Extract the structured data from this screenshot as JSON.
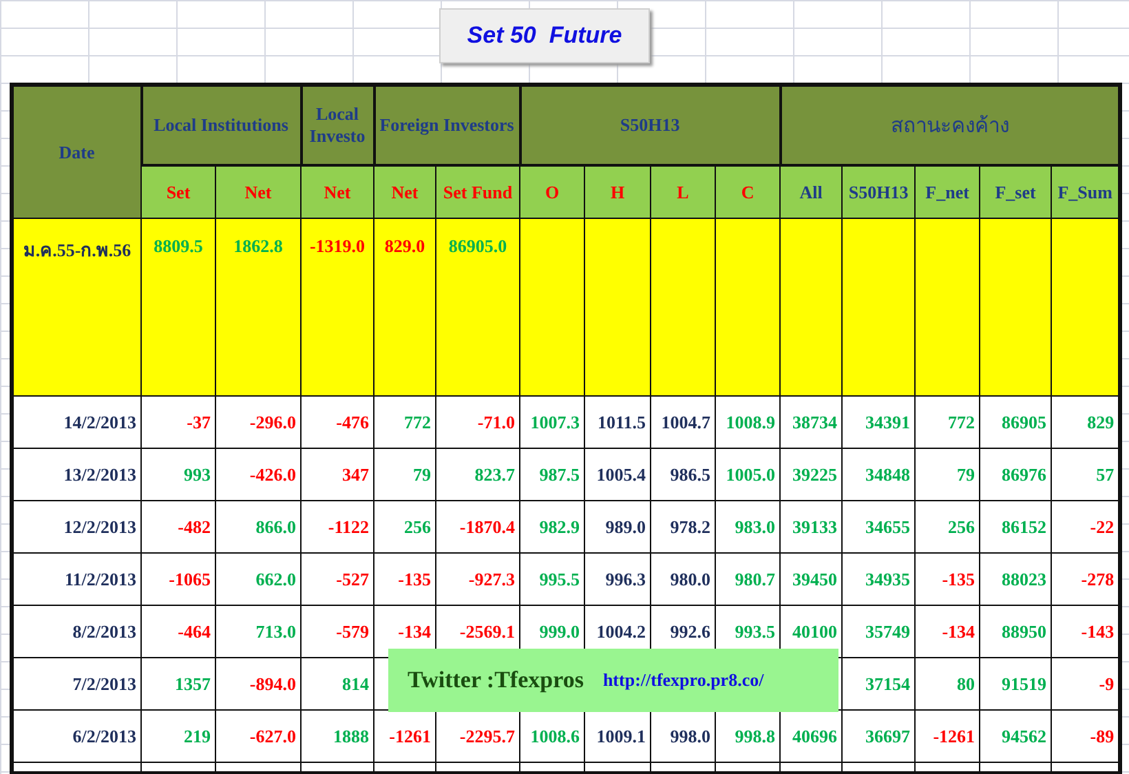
{
  "title": "Set 50  Future",
  "header": {
    "groups": [
      {
        "label": "Date"
      },
      {
        "label": "Local Institutions",
        "kind": "flow",
        "columns": [
          "Set",
          "Net"
        ]
      },
      {
        "label": "Local Investo",
        "kind": "flow",
        "columns": [
          "Net"
        ]
      },
      {
        "label": "Foreign Investors",
        "kind": "flow",
        "columns": [
          "Net",
          "Set Fund"
        ]
      },
      {
        "label": "S50H13",
        "kind": "flow",
        "columns": [
          "O",
          "H",
          "L",
          "C"
        ]
      },
      {
        "label": "สถานะคงค้าง",
        "kind": "position",
        "columns": [
          "All",
          "S50H13",
          "F_net",
          "F_set",
          "F_Sum"
        ]
      }
    ]
  },
  "summary": {
    "label": "ม.ค.55-ก.พ.56",
    "cells": [
      {
        "text": "8809.5",
        "color": "#00b050"
      },
      {
        "text": "1862.8",
        "color": "#00b050"
      },
      {
        "text": "-1319.0",
        "color": "#ff0000"
      },
      {
        "text": "829.0",
        "color": "#ff0000"
      },
      {
        "text": "86905.0",
        "color": "#00b050"
      }
    ]
  },
  "rows": [
    {
      "date": "14/2/2013",
      "cells": [
        {
          "text": "-37",
          "color": "#ff0000"
        },
        {
          "text": "-296.0",
          "color": "#ff0000"
        },
        {
          "text": "-476",
          "color": "#ff0000"
        },
        {
          "text": "772",
          "color": "#00b050"
        },
        {
          "text": "-71.0",
          "color": "#ff0000"
        },
        {
          "text": "1007.3",
          "color": "#00b050"
        },
        {
          "text": "1011.5",
          "color": "#1f2f5c"
        },
        {
          "text": "1004.7",
          "color": "#1f2f5c"
        },
        {
          "text": "1008.9",
          "color": "#00b050"
        },
        {
          "text": "38734",
          "color": "#00b050"
        },
        {
          "text": "34391",
          "color": "#00b050"
        },
        {
          "text": "772",
          "color": "#00b050"
        },
        {
          "text": "86905",
          "color": "#00b050"
        },
        {
          "text": "829",
          "color": "#00b050"
        }
      ]
    },
    {
      "date": "13/2/2013",
      "cells": [
        {
          "text": "993",
          "color": "#00b050"
        },
        {
          "text": "-426.0",
          "color": "#ff0000"
        },
        {
          "text": "347",
          "color": "#ff0000"
        },
        {
          "text": "79",
          "color": "#00b050"
        },
        {
          "text": "823.7",
          "color": "#00b050"
        },
        {
          "text": "987.5",
          "color": "#00b050"
        },
        {
          "text": "1005.4",
          "color": "#1f2f5c"
        },
        {
          "text": "986.5",
          "color": "#1f2f5c"
        },
        {
          "text": "1005.0",
          "color": "#00b050"
        },
        {
          "text": "39225",
          "color": "#00b050"
        },
        {
          "text": "34848",
          "color": "#00b050"
        },
        {
          "text": "79",
          "color": "#00b050"
        },
        {
          "text": "86976",
          "color": "#00b050"
        },
        {
          "text": "57",
          "color": "#00b050"
        }
      ]
    },
    {
      "date": "12/2/2013",
      "cells": [
        {
          "text": "-482",
          "color": "#ff0000"
        },
        {
          "text": "866.0",
          "color": "#00b050"
        },
        {
          "text": "-1122",
          "color": "#ff0000"
        },
        {
          "text": "256",
          "color": "#00b050"
        },
        {
          "text": "-1870.4",
          "color": "#ff0000"
        },
        {
          "text": "982.9",
          "color": "#00b050"
        },
        {
          "text": "989.0",
          "color": "#1f2f5c"
        },
        {
          "text": "978.2",
          "color": "#1f2f5c"
        },
        {
          "text": "983.0",
          "color": "#00b050"
        },
        {
          "text": "39133",
          "color": "#00b050"
        },
        {
          "text": "34655",
          "color": "#00b050"
        },
        {
          "text": "256",
          "color": "#00b050"
        },
        {
          "text": "86152",
          "color": "#00b050"
        },
        {
          "text": "-22",
          "color": "#ff0000"
        }
      ]
    },
    {
      "date": "11/2/2013",
      "cells": [
        {
          "text": "-1065",
          "color": "#ff0000"
        },
        {
          "text": "662.0",
          "color": "#00b050"
        },
        {
          "text": "-527",
          "color": "#ff0000"
        },
        {
          "text": "-135",
          "color": "#ff0000"
        },
        {
          "text": "-927.3",
          "color": "#ff0000"
        },
        {
          "text": "995.5",
          "color": "#00b050"
        },
        {
          "text": "996.3",
          "color": "#1f2f5c"
        },
        {
          "text": "980.0",
          "color": "#1f2f5c"
        },
        {
          "text": "980.7",
          "color": "#00b050"
        },
        {
          "text": "39450",
          "color": "#00b050"
        },
        {
          "text": "34935",
          "color": "#00b050"
        },
        {
          "text": "-135",
          "color": "#ff0000"
        },
        {
          "text": "88023",
          "color": "#00b050"
        },
        {
          "text": "-278",
          "color": "#ff0000"
        }
      ]
    },
    {
      "date": "8/2/2013",
      "cells": [
        {
          "text": "-464",
          "color": "#ff0000"
        },
        {
          "text": "713.0",
          "color": "#00b050"
        },
        {
          "text": "-579",
          "color": "#ff0000"
        },
        {
          "text": "-134",
          "color": "#ff0000"
        },
        {
          "text": "-2569.1",
          "color": "#ff0000"
        },
        {
          "text": "999.0",
          "color": "#00b050"
        },
        {
          "text": "1004.2",
          "color": "#1f2f5c"
        },
        {
          "text": "992.6",
          "color": "#1f2f5c"
        },
        {
          "text": "993.5",
          "color": "#00b050"
        },
        {
          "text": "40100",
          "color": "#00b050"
        },
        {
          "text": "35749",
          "color": "#00b050"
        },
        {
          "text": "-134",
          "color": "#ff0000"
        },
        {
          "text": "88950",
          "color": "#00b050"
        },
        {
          "text": "-143",
          "color": "#ff0000"
        }
      ]
    },
    {
      "date": "7/2/2013",
      "cells": [
        {
          "text": "1357",
          "color": "#00b050"
        },
        {
          "text": "-894.0",
          "color": "#ff0000"
        },
        {
          "text": "814",
          "color": "#00b050"
        },
        null,
        null,
        null,
        null,
        null,
        null,
        null,
        {
          "text": "37154",
          "color": "#00b050"
        },
        {
          "text": "80",
          "color": "#00b050"
        },
        {
          "text": "91519",
          "color": "#00b050"
        },
        {
          "text": "-9",
          "color": "#ff0000"
        }
      ]
    },
    {
      "date": "6/2/2013",
      "cells": [
        {
          "text": "219",
          "color": "#00b050"
        },
        {
          "text": "-627.0",
          "color": "#ff0000"
        },
        {
          "text": "1888",
          "color": "#00b050"
        },
        {
          "text": "-1261",
          "color": "#ff0000"
        },
        {
          "text": "-2295.7",
          "color": "#ff0000"
        },
        {
          "text": "1008.6",
          "color": "#00b050"
        },
        {
          "text": "1009.1",
          "color": "#1f2f5c"
        },
        {
          "text": "998.0",
          "color": "#1f2f5c"
        },
        {
          "text": "998.8",
          "color": "#00b050"
        },
        {
          "text": "40696",
          "color": "#00b050"
        },
        {
          "text": "36697",
          "color": "#00b050"
        },
        {
          "text": "-1261",
          "color": "#ff0000"
        },
        {
          "text": "94562",
          "color": "#00b050"
        },
        {
          "text": "-89",
          "color": "#ff0000"
        }
      ]
    }
  ],
  "banner": {
    "text": "Twitter :Tfexpros",
    "link": "http://tfexpro.pr8.co/"
  }
}
